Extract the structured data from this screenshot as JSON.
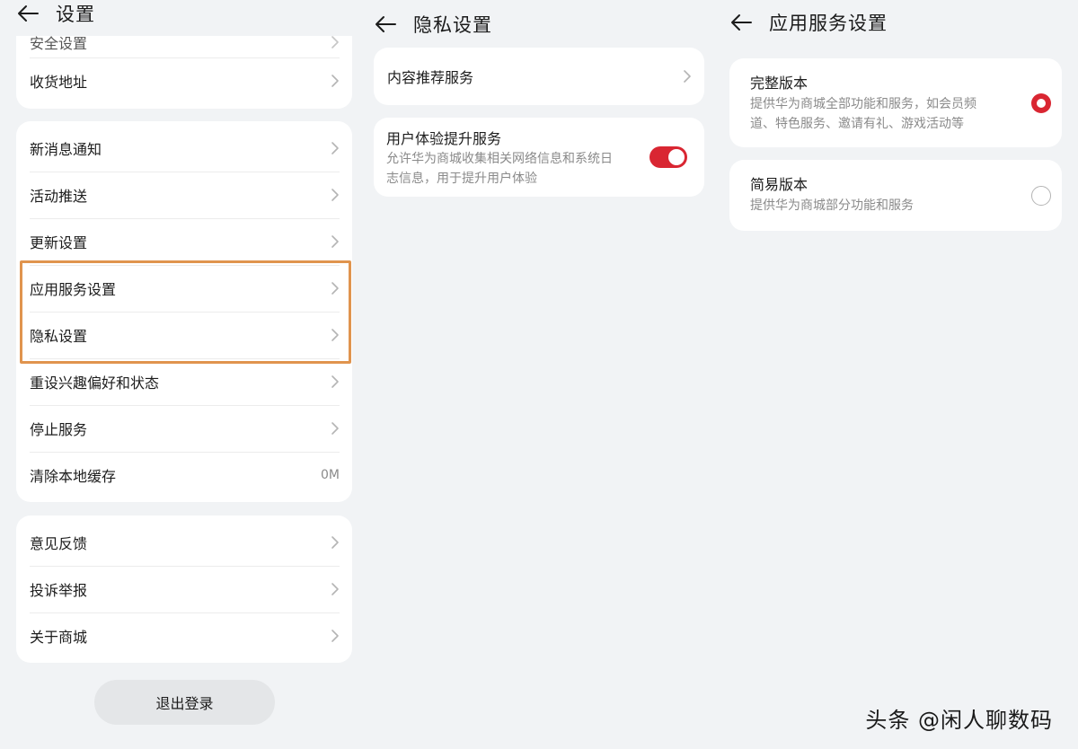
{
  "settings": {
    "title": "设置",
    "partial_item": "安全设置",
    "card1": [
      {
        "label": "收货地址"
      }
    ],
    "card2": [
      {
        "label": "新消息通知"
      },
      {
        "label": "活动推送"
      },
      {
        "label": "更新设置"
      },
      {
        "label": "应用服务设置"
      },
      {
        "label": "隐私设置"
      },
      {
        "label": "重设兴趣偏好和状态"
      },
      {
        "label": "停止服务"
      },
      {
        "label": "清除本地缓存",
        "value": "0M"
      }
    ],
    "card3": [
      {
        "label": "意见反馈"
      },
      {
        "label": "投诉举报"
      },
      {
        "label": "关于商城"
      }
    ],
    "logout_label": "退出登录"
  },
  "privacy": {
    "title": "隐私设置",
    "content_recommend": "内容推荐服务",
    "ux_title": "用户体验提升服务",
    "ux_desc_line1": "允许华为商城收集相关网络信息和系统日",
    "ux_desc_line2": "志信息，用于提升用户体验",
    "ux_toggle_on": true
  },
  "app_service": {
    "title": "应用服务设置",
    "full": {
      "title": "完整版本",
      "desc_line1": "提供华为商城全部功能和服务，如会员频",
      "desc_line2": "道、特色服务、邀请有礼、游戏活动等",
      "selected": true
    },
    "simple": {
      "title": "简易版本",
      "desc_line1": "提供华为商城部分功能和服务",
      "selected": false
    }
  },
  "colors": {
    "accent": "#d92632",
    "highlight_border": "#e0944e",
    "background": "#f1f3f5"
  },
  "watermark": "头条 @闲人聊数码"
}
